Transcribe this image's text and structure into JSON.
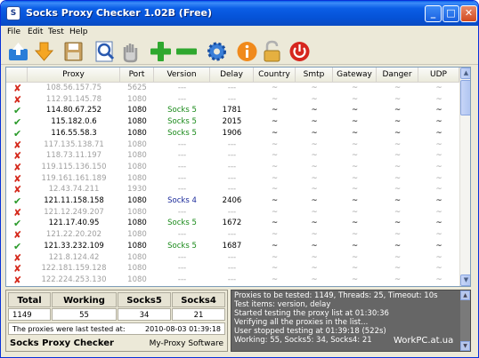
{
  "window": {
    "title": "Socks Proxy Checker 1.02B (Free)",
    "icon_label": "S"
  },
  "window_buttons": {
    "minimize": "_",
    "maximize": "□",
    "close": "✕"
  },
  "menu": [
    "File",
    "Edit",
    "Test",
    "Help"
  ],
  "toolbar": [
    {
      "name": "import-icon",
      "color": "#2a7ed8"
    },
    {
      "name": "download-icon",
      "color": "#f5a623"
    },
    {
      "name": "save-icon",
      "color": "#c8a060"
    },
    {
      "name": "search-icon",
      "color": "#4a8ee0"
    },
    {
      "name": "hand-icon",
      "color": "#bdbdbd"
    },
    {
      "name": "add-icon",
      "color": "#2fa82f"
    },
    {
      "name": "remove-icon",
      "color": "#2fa82f"
    },
    {
      "name": "gear-icon",
      "color": "#3a7fd8"
    },
    {
      "name": "info-icon",
      "color": "#f08a1c"
    },
    {
      "name": "lock-icon",
      "color": "#e5b040"
    },
    {
      "name": "power-icon",
      "color": "#d6261e"
    }
  ],
  "table": {
    "columns": [
      "Proxy",
      "Port",
      "Version",
      "Delay",
      "Country",
      "Smtp",
      "Gateway",
      "Danger",
      "UDP"
    ],
    "rows": [
      {
        "ok": false,
        "proxy": "108.56.157.75",
        "port": "5625",
        "version": "---",
        "delay": "---",
        "country": "~",
        "smtp": "~",
        "gateway": "~",
        "danger": "~",
        "udp": "~"
      },
      {
        "ok": false,
        "proxy": "112.91.145.78",
        "port": "1080",
        "version": "---",
        "delay": "---",
        "country": "~",
        "smtp": "~",
        "gateway": "~",
        "danger": "~",
        "udp": "~"
      },
      {
        "ok": true,
        "proxy": "114.80.67.252",
        "port": "1080",
        "version": "Socks 5",
        "delay": "1781",
        "country": "~",
        "smtp": "~",
        "gateway": "~",
        "danger": "~",
        "udp": "~"
      },
      {
        "ok": true,
        "proxy": "115.182.0.6",
        "port": "1080",
        "version": "Socks 5",
        "delay": "2015",
        "country": "~",
        "smtp": "~",
        "gateway": "~",
        "danger": "~",
        "udp": "~"
      },
      {
        "ok": true,
        "proxy": "116.55.58.3",
        "port": "1080",
        "version": "Socks 5",
        "delay": "1906",
        "country": "~",
        "smtp": "~",
        "gateway": "~",
        "danger": "~",
        "udp": "~"
      },
      {
        "ok": false,
        "proxy": "117.135.138.71",
        "port": "1080",
        "version": "---",
        "delay": "---",
        "country": "~",
        "smtp": "~",
        "gateway": "~",
        "danger": "~",
        "udp": "~"
      },
      {
        "ok": false,
        "proxy": "118.73.11.197",
        "port": "1080",
        "version": "---",
        "delay": "---",
        "country": "~",
        "smtp": "~",
        "gateway": "~",
        "danger": "~",
        "udp": "~"
      },
      {
        "ok": false,
        "proxy": "119.115.136.150",
        "port": "1080",
        "version": "---",
        "delay": "---",
        "country": "~",
        "smtp": "~",
        "gateway": "~",
        "danger": "~",
        "udp": "~"
      },
      {
        "ok": false,
        "proxy": "119.161.161.189",
        "port": "1080",
        "version": "---",
        "delay": "---",
        "country": "~",
        "smtp": "~",
        "gateway": "~",
        "danger": "~",
        "udp": "~"
      },
      {
        "ok": false,
        "proxy": "12.43.74.211",
        "port": "1930",
        "version": "---",
        "delay": "---",
        "country": "~",
        "smtp": "~",
        "gateway": "~",
        "danger": "~",
        "udp": "~"
      },
      {
        "ok": true,
        "proxy": "121.11.158.158",
        "port": "1080",
        "version": "Socks 4",
        "delay": "2406",
        "country": "~",
        "smtp": "~",
        "gateway": "~",
        "danger": "~",
        "udp": "~"
      },
      {
        "ok": false,
        "proxy": "121.12.249.207",
        "port": "1080",
        "version": "---",
        "delay": "---",
        "country": "~",
        "smtp": "~",
        "gateway": "~",
        "danger": "~",
        "udp": "~"
      },
      {
        "ok": true,
        "proxy": "121.17.40.95",
        "port": "1080",
        "version": "Socks 5",
        "delay": "1672",
        "country": "~",
        "smtp": "~",
        "gateway": "~",
        "danger": "~",
        "udp": "~"
      },
      {
        "ok": false,
        "proxy": "121.22.20.202",
        "port": "1080",
        "version": "---",
        "delay": "---",
        "country": "~",
        "smtp": "~",
        "gateway": "~",
        "danger": "~",
        "udp": "~"
      },
      {
        "ok": true,
        "proxy": "121.33.232.109",
        "port": "1080",
        "version": "Socks 5",
        "delay": "1687",
        "country": "~",
        "smtp": "~",
        "gateway": "~",
        "danger": "~",
        "udp": "~"
      },
      {
        "ok": false,
        "proxy": "121.8.124.42",
        "port": "1080",
        "version": "---",
        "delay": "---",
        "country": "~",
        "smtp": "~",
        "gateway": "~",
        "danger": "~",
        "udp": "~"
      },
      {
        "ok": false,
        "proxy": "122.181.159.128",
        "port": "1080",
        "version": "---",
        "delay": "---",
        "country": "~",
        "smtp": "~",
        "gateway": "~",
        "danger": "~",
        "udp": "~"
      },
      {
        "ok": false,
        "proxy": "122.224.253.130",
        "port": "1080",
        "version": "---",
        "delay": "---",
        "country": "~",
        "smtp": "~",
        "gateway": "~",
        "danger": "~",
        "udp": "~"
      }
    ]
  },
  "summary": {
    "headers": [
      "Total",
      "Working",
      "Socks5",
      "Socks4"
    ],
    "values": [
      "1149",
      "55",
      "34",
      "21"
    ],
    "last_tested_label": "The proxies were last tested at:",
    "last_tested_value": "2010-08-03 01:39:18",
    "app_name": "Socks Proxy Checker",
    "vendor": "My-Proxy Software"
  },
  "log": [
    "Proxies to be tested: 1149, Threads: 25, Timeout: 10s",
    "Test items: version, delay",
    "Started testing the proxy list at 01:30:36",
    "Verifying all the proxies in the list...",
    "User stopped testing at 01:39:18 (522s)",
    "Working: 55, Socks5: 34, Socks4: 21"
  ],
  "watermark": "WorkPC.at.ua"
}
